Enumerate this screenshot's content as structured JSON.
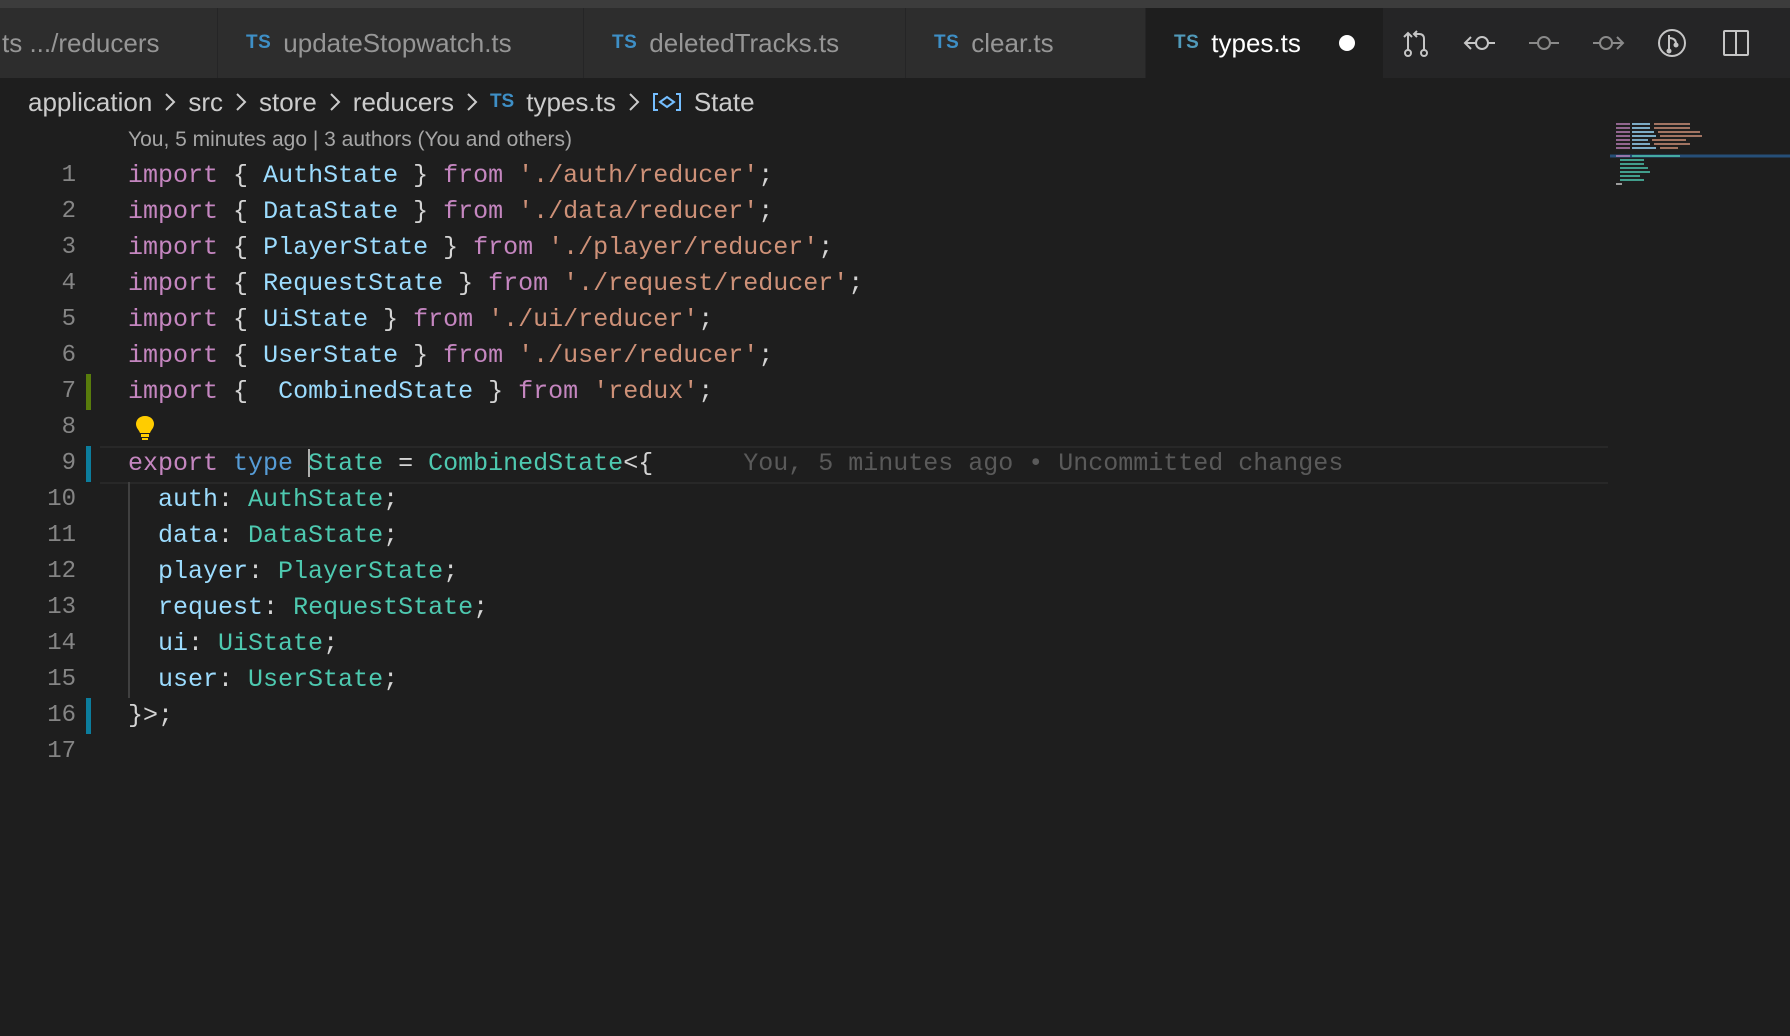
{
  "tabs": [
    {
      "label": "ts .../reducers",
      "badge": "",
      "active": false
    },
    {
      "label": "updateStopwatch.ts",
      "badge": "TS",
      "active": false
    },
    {
      "label": "deletedTracks.ts",
      "badge": "TS",
      "active": false
    },
    {
      "label": "clear.ts",
      "badge": "TS",
      "active": false
    },
    {
      "label": "types.ts",
      "badge": "TS",
      "active": true
    }
  ],
  "actions": [
    "source-control-compare-icon",
    "previous-change-icon",
    "commit-icon",
    "next-change-icon",
    "git-graph-icon",
    "split-editor-icon"
  ],
  "breadcrumb": {
    "items": [
      "application",
      "src",
      "store",
      "reducers"
    ],
    "file_badge": "TS",
    "file": "types.ts",
    "symbol": "State"
  },
  "codelens": "You, 5 minutes ago | 3 authors (You and others)",
  "code": {
    "line_numbers": [
      "1",
      "2",
      "3",
      "4",
      "5",
      "6",
      "7",
      "8",
      "9",
      "10",
      "11",
      "12",
      "13",
      "14",
      "15",
      "16",
      "17"
    ],
    "import_kw": "import",
    "from_kw": "from",
    "lbrace": "{",
    "rbrace": "}",
    "semi": ";",
    "imports": [
      {
        "name": "AuthState",
        "path": "'./auth/reducer'"
      },
      {
        "name": "DataState",
        "path": "'./data/reducer'"
      },
      {
        "name": "PlayerState",
        "path": "'./player/reducer'"
      },
      {
        "name": "RequestState",
        "path": "'./request/reducer'"
      },
      {
        "name": "UiState",
        "path": "'./ui/reducer'"
      },
      {
        "name": "UserState",
        "path": "'./user/reducer'"
      },
      {
        "name": " CombinedState",
        "path": "'redux'"
      }
    ],
    "export_kw": "export",
    "type_kw": "type",
    "state_first_char": "S",
    "state_rest": "tate",
    "equals": "=",
    "combined": "CombinedState",
    "open_generic": "<{",
    "blame": "You, 5 minutes ago • Uncommitted changes",
    "fields": [
      {
        "key": "auth",
        "type": "AuthState"
      },
      {
        "key": "data",
        "type": "DataState"
      },
      {
        "key": "player",
        "type": "PlayerState"
      },
      {
        "key": "request",
        "type": "RequestState"
      },
      {
        "key": "ui",
        "type": "UiState"
      },
      {
        "key": "user",
        "type": "UserState"
      }
    ],
    "close": "}>;"
  },
  "colors": {
    "background": "#1e1e1e",
    "keyword": "#c586c0",
    "type": "#4ec9b0",
    "variable": "#9cdcfe",
    "string": "#ce9178",
    "gutter_added": "#587c0c",
    "gutter_modified": "#0c7d9d"
  }
}
